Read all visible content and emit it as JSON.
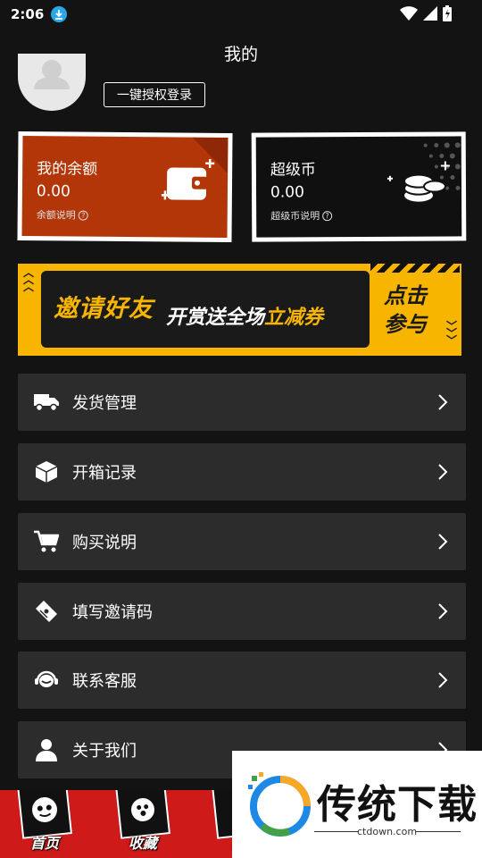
{
  "status_bar": {
    "time": "2:06"
  },
  "header": {
    "title": "我的"
  },
  "profile": {
    "login_label": "一键授权登录"
  },
  "wallet": {
    "balance": {
      "title": "我的余额",
      "value": "0.00",
      "note": "余额说明"
    },
    "coin": {
      "title": "超级币",
      "value": "0.00",
      "note": "超级币说明"
    }
  },
  "banner": {
    "left_text": "邀请好友",
    "mid_text": "开赏送全场",
    "mid_highlight": "立减券",
    "right_text_1": "点击",
    "right_text_2": "参与"
  },
  "menu": {
    "items": [
      {
        "label": "发货管理",
        "icon": "truck-icon"
      },
      {
        "label": "开箱记录",
        "icon": "box-icon"
      },
      {
        "label": "购买说明",
        "icon": "cart-icon"
      },
      {
        "label": "填写邀请码",
        "icon": "ticket-icon"
      },
      {
        "label": "联系客服",
        "icon": "headset-icon"
      },
      {
        "label": "关于我们",
        "icon": "person-icon"
      }
    ]
  },
  "bottom_nav": {
    "items": [
      {
        "label": "首页"
      },
      {
        "label": "收藏"
      },
      {
        "label": "换"
      }
    ]
  },
  "watermark": {
    "text": "传统下载",
    "url": "ctdown.com"
  },
  "colors": {
    "background": "#131313",
    "menu_bg": "#2c2c2c",
    "balance_card": "#b23608",
    "banner": "#f7b500",
    "nav": "#cf1a1a"
  }
}
